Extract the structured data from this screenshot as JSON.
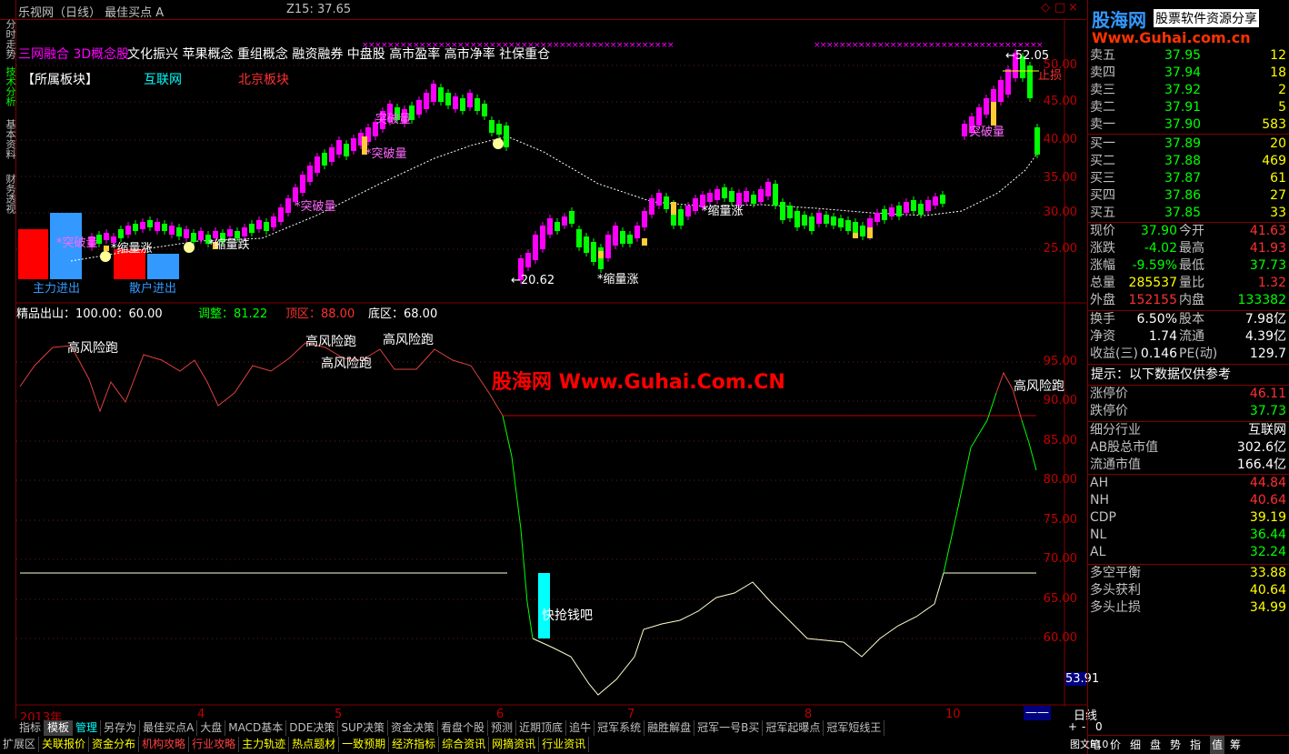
{
  "title": "乐视网（日线） 最佳买点 A",
  "z15": "Z15: 37.65",
  "window_controls": [
    "◇",
    "□",
    "×"
  ],
  "left_tabs": [
    "分时走势",
    "技术分析",
    "基本资料",
    "财务透视"
  ],
  "concept_line": {
    "overlap": "三网融合 3D概念股",
    "items": "文化振兴  苹果概念  重组概念  融资融券  中盘股  高市盈率  高市净率  社保重仓"
  },
  "sector_line": {
    "label": "【所属板块】",
    "item1": "互联网",
    "item2": "北京板块"
  },
  "upper_annotations": {
    "tupo1": "*突破量",
    "tupo2": "*突破量",
    "tupo3": "*突破量",
    "tupo4": "突破量",
    "tupo5": "突破量",
    "suo1": "*缩量涨",
    "suo2": "*缩量涨",
    "suo3": "*缩量跌",
    "suo4": "*缩量涨",
    "suo5": "*缩量涨",
    "low_price": "←20.62",
    "high_price": "←52.05",
    "stop_loss": "止损",
    "main_flow": "主力进出",
    "retail_flow": "散户进出"
  },
  "upper_axis": [
    "50.00",
    "45.00",
    "40.00",
    "35.00",
    "30.00",
    "25.00"
  ],
  "indicator_header": {
    "name": "精品出山：100.00：60.00",
    "adjust": "调整：81.22",
    "top": "顶区：88.00",
    "bottom": "底区：68.00"
  },
  "indicator_labels": {
    "risk1": "高风险跑",
    "risk2": "高风险跑",
    "risk3": "高风险跑",
    "risk4": "高风险跑",
    "risk5": "高风险跑",
    "grab": "快抢钱吧"
  },
  "watermark": "股海网 Www.Guhai.Com.CN",
  "lower_axis": [
    "95.00",
    "90.00",
    "85.00",
    "80.00",
    "75.00",
    "70.00",
    "65.00",
    "60.00"
  ],
  "lower_current": "53.91",
  "x_axis": {
    "year": "2013年",
    "m4": "4",
    "m5": "5",
    "m6": "6",
    "m7": "7",
    "m8": "8",
    "m10": "10",
    "period": "日线",
    "nav": "——"
  },
  "tabs_row1": [
    "指标",
    "模板",
    "管理",
    "另存为",
    "最佳买点A",
    "大盘",
    "MACD基本",
    "DDE决策",
    "SUP决策",
    "资金决策",
    "看盘个股",
    "预测",
    "近期顶底",
    "追牛",
    "冠军系统",
    "融胜解盘",
    "冠军一号B买",
    "冠军起曝点",
    "冠军短线王"
  ],
  "tabs_row2": [
    "扩展区",
    "关联报价",
    "资金分布",
    "机构攻略",
    "行业攻略",
    "主力轨迹",
    "热点题材",
    "一致预期",
    "经济指标",
    "综合资讯",
    "网摘资讯",
    "行业资讯"
  ],
  "zoom_controls": [
    "+",
    "-",
    "0"
  ],
  "logo": {
    "cn": "股海网",
    "slogan": "股票软件资源分享",
    "url": "Www.Guhai.com.cn"
  },
  "order_book": {
    "asks": [
      {
        "label": "卖五",
        "price": "37.95",
        "vol": "12"
      },
      {
        "label": "卖四",
        "price": "37.94",
        "vol": "18"
      },
      {
        "label": "卖三",
        "price": "37.92",
        "vol": "2"
      },
      {
        "label": "卖二",
        "price": "37.91",
        "vol": "5"
      },
      {
        "label": "卖一",
        "price": "37.90",
        "vol": "583"
      }
    ],
    "bids": [
      {
        "label": "买一",
        "price": "37.89",
        "vol": "20"
      },
      {
        "label": "买二",
        "price": "37.88",
        "vol": "469"
      },
      {
        "label": "买三",
        "price": "37.87",
        "vol": "61"
      },
      {
        "label": "买四",
        "price": "37.86",
        "vol": "27"
      },
      {
        "label": "买五",
        "price": "37.85",
        "vol": "33"
      }
    ]
  },
  "quote": [
    {
      "l1": "现价",
      "v1": "37.90",
      "l2": "今开",
      "v2": "41.63"
    },
    {
      "l1": "涨跌",
      "v1": "-4.02",
      "l2": "最高",
      "v2": "41.93"
    },
    {
      "l1": "涨幅",
      "v1": "-9.59%",
      "l2": "最低",
      "v2": "37.73"
    },
    {
      "l1": "总量",
      "v1": "285537",
      "l2": "量比",
      "v2": "1.32"
    },
    {
      "l1": "外盘",
      "v1": "152155",
      "l2": "内盘",
      "v2": "133382"
    }
  ],
  "fundamentals": [
    {
      "l1": "换手",
      "v1": "6.50%",
      "l2": "股本",
      "v2": "7.98亿"
    },
    {
      "l1": "净资",
      "v1": "1.74",
      "l2": "流通",
      "v2": "4.39亿"
    },
    {
      "l1": "收益(三)",
      "v1": "0.146",
      "l2": "PE(动)",
      "v2": "129.7"
    }
  ],
  "notice": "提示：以下数据仅供参考",
  "limits": [
    {
      "label": "涨停价",
      "value": "46.11"
    },
    {
      "label": "跌停价",
      "value": "37.73"
    }
  ],
  "industry": [
    {
      "label": "细分行业",
      "value": "互联网"
    },
    {
      "label": "AB股总市值",
      "value": "302.6亿"
    },
    {
      "label": "流通市值",
      "value": "166.4亿"
    }
  ],
  "levels": [
    {
      "label": "AH",
      "value": "44.84"
    },
    {
      "label": "NH",
      "value": "40.64"
    },
    {
      "label": "CDP",
      "value": "39.19"
    },
    {
      "label": "NL",
      "value": "36.44"
    },
    {
      "label": "AL",
      "value": "32.24"
    }
  ],
  "balance": [
    {
      "label": "多空平衡",
      "value": "33.88"
    },
    {
      "label": "多头获利",
      "value": "40.64"
    },
    {
      "label": "多头止损",
      "value": "34.99"
    }
  ],
  "right_tabs": [
    "笔",
    "价",
    "细",
    "盘",
    "势",
    "指",
    "值",
    "筹"
  ],
  "right_bottom": "图文F10",
  "colors": {
    "up": "#ff3030",
    "down": "#00ff00",
    "frame": "#800000",
    "yellow": "#ffff00",
    "magenta": "#ff00ff",
    "cyan": "#00ffff"
  }
}
